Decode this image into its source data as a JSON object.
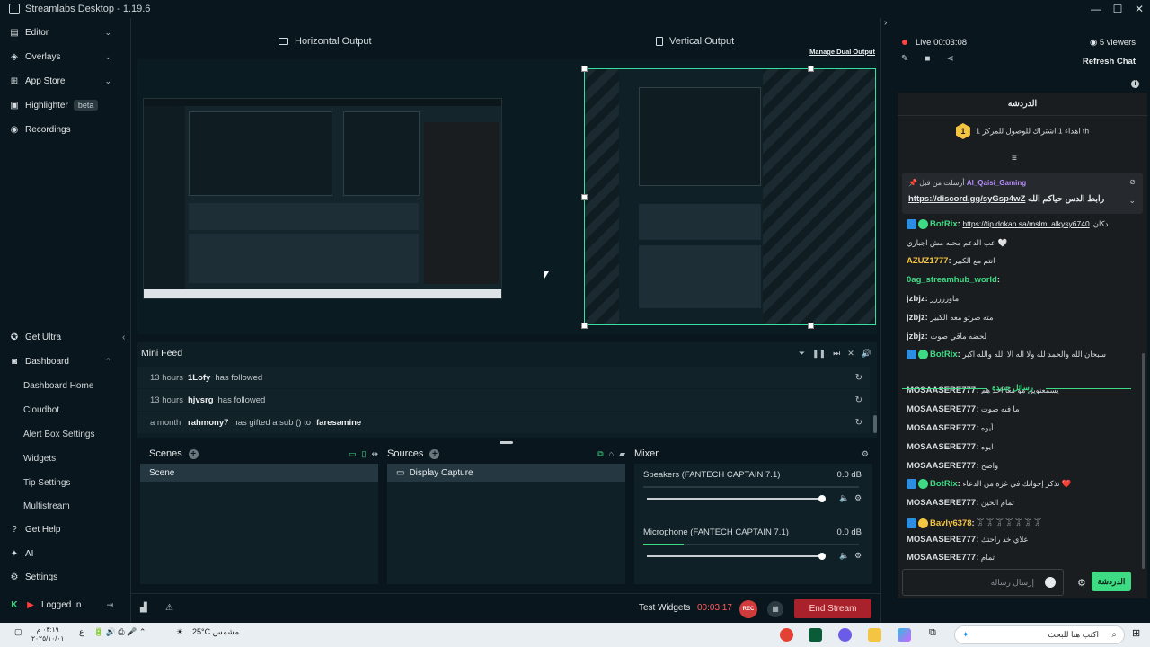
{
  "window": {
    "title": "Streamlabs Desktop - 1.19.6",
    "controls": [
      "—",
      "☐",
      "✕"
    ]
  },
  "sidebar": {
    "top_items": [
      {
        "label": "Editor",
        "icon": "editor-icon",
        "chevron": "⌄"
      },
      {
        "label": "Overlays",
        "icon": "overlays-icon",
        "chevron": "⌄"
      },
      {
        "label": "App Store",
        "icon": "app-store-icon",
        "chevron": "⌄"
      },
      {
        "label": "Highlighter",
        "icon": "highlighter-icon",
        "badge": "beta"
      },
      {
        "label": "Recordings",
        "icon": "recordings-icon"
      }
    ],
    "get_ultra": "Get Ultra",
    "dashboard": {
      "label": "Dashboard",
      "chevron": "⌃"
    },
    "dashboard_items": [
      "Dashboard Home",
      "Cloudbot",
      "Alert Box Settings",
      "Widgets",
      "Tip Settings",
      "Multistream"
    ],
    "get_help": "Get Help",
    "ai": "AI",
    "settings": "Settings",
    "logged_in": "Logged In"
  },
  "outputs": {
    "horizontal": "Horizontal Output",
    "vertical": "Vertical Output",
    "manage_dual": "Manage Dual Output"
  },
  "mini_feed": {
    "title": "Mini Feed",
    "rows": [
      {
        "time": "13 hours",
        "user": "1Lofy",
        "action": "has followed",
        "target": ""
      },
      {
        "time": "13 hours",
        "user": "hjvsrg",
        "action": "has followed",
        "target": ""
      },
      {
        "time": "a month",
        "user": "rahmony7",
        "action": "has gifted a sub () to",
        "target": "faresamine"
      }
    ]
  },
  "scenes": {
    "title": "Scenes",
    "items": [
      "Scene"
    ]
  },
  "sources": {
    "title": "Sources",
    "items": [
      "Display Capture"
    ]
  },
  "mixer": {
    "title": "Mixer",
    "channels": [
      {
        "name": "Speakers (FANTECH CAPTAIN 7.1)",
        "db": "0.0 dB",
        "level": 1.0
      },
      {
        "name": "Microphone (FANTECH CAPTAIN 7.1)",
        "db": "0.0 dB",
        "level": 1.0
      }
    ]
  },
  "bottom": {
    "test_widgets": "Test Widgets",
    "timer": "00:03:17",
    "rec": "REC",
    "end_stream": "End Stream"
  },
  "stream": {
    "live_label": "Live 00:03:08",
    "viewers": "5 viewers",
    "refresh_chat": "Refresh Chat"
  },
  "chat": {
    "header": "الدردشة",
    "sub_goal_count": "1",
    "sub_goal_text": "اهداء 1 اشتراك للوصول للمركز 1 th",
    "pinned_by": "أرسلت من قبل",
    "pinned_user": "Al_Qaisi_Gaming",
    "pinned_link": "https://discord.gg/syGsp4wZ",
    "pinned_text": "رابط الدس حياكم الله",
    "new_messages": "رسائل جديدة",
    "messages": [
      {
        "user": "BotRix",
        "text": "https://tip.dokan.sa/mslm_alkysy6740",
        "tail": "دكان",
        "color": "#3ddc84",
        "badges": true,
        "link": true
      },
      {
        "user": "",
        "text": "عب الدعم محبه مش اجباري 🤍",
        "color": "#d5dcdf"
      },
      {
        "user": "AZUZ1777",
        "text": "انتم مع الكبير",
        "color": "#f5c542"
      },
      {
        "user": "0ag_streamhub_world",
        "text": "",
        "color": "#3ddc84"
      },
      {
        "user": "jzbjz",
        "text": "ماوررررر",
        "color": "#d5dcdf"
      },
      {
        "user": "jzbjz",
        "text": "مته صرتو معه الكبير",
        "color": "#d5dcdf"
      },
      {
        "user": "jzbjz",
        "text": "لحضه ماقي صوت",
        "color": "#d5dcdf"
      },
      {
        "user": "BotRix",
        "text": "سبحان الله والحمد لله ولا اله الا الله والله اكبر",
        "color": "#3ddc84",
        "badges": true
      },
      {
        "user": "MOSAASERE777",
        "text": "يسمعنوين مو معا احد هم",
        "color": "#d5dcdf"
      },
      {
        "user": "MOSAASERE777",
        "text": "ما فيه صوت",
        "color": "#d5dcdf"
      },
      {
        "user": "MOSAASERE777",
        "text": "أيوه",
        "color": "#d5dcdf"
      },
      {
        "user": "MOSAASERE777",
        "text": "ايوه",
        "color": "#d5dcdf"
      },
      {
        "user": "MOSAASERE777",
        "text": "واضح",
        "color": "#d5dcdf"
      },
      {
        "user": "BotRix",
        "text": "تذكر إخوانك في غزة من الدعاء ❤️",
        "color": "#3ddc84",
        "badges": true
      },
      {
        "user": "MOSAASERE777",
        "text": "تمام الحين",
        "color": "#d5dcdf"
      },
      {
        "user": "Bavly6378",
        "text": "𓀠 𓀠 𓀠 𓀠 𓀠 𓀠 𓀠",
        "color": "#f5c542",
        "badges": true
      },
      {
        "user": "MOSAASERE777",
        "text": "علاي خذ راحتك",
        "color": "#d5dcdf"
      },
      {
        "user": "MOSAASERE777",
        "text": "تمام",
        "color": "#d5dcdf"
      }
    ],
    "input_placeholder": "إرسال رسالة",
    "send_label": "الدردشة"
  },
  "taskbar": {
    "search_placeholder": "اكتب هنا للبحث",
    "weather": "25°C مشمس",
    "time": "٠٣:١٩ م",
    "date": "٢٠٢٥/١٠/٠١"
  },
  "colors": {
    "accent": "#3ddc84",
    "danger": "#a9222b",
    "live": "#ff4444",
    "bg": "#09161d"
  }
}
